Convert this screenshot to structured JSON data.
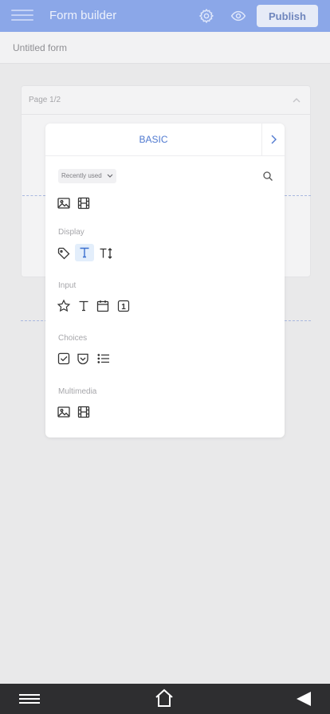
{
  "header": {
    "title": "Form builder",
    "publish_label": "Publish",
    "icons": [
      "menu-icon",
      "gear-icon",
      "eye-icon"
    ]
  },
  "form": {
    "name": "Untitled form"
  },
  "page": {
    "label": "Page 1/2"
  },
  "panel": {
    "tab_label": "BASIC",
    "filter_label": "Recently used",
    "sections": [
      {
        "label": "",
        "items": [
          "image",
          "video"
        ]
      },
      {
        "label": "Display",
        "items": [
          "tag",
          "text",
          "text-resize"
        ]
      },
      {
        "label": "Input",
        "items": [
          "star-rating",
          "text",
          "date",
          "number"
        ]
      },
      {
        "label": "Choices",
        "items": [
          "checkbox",
          "dropdown",
          "list"
        ]
      },
      {
        "label": "Multimedia",
        "items": [
          "image",
          "video"
        ]
      }
    ],
    "number_glyph": "1"
  },
  "colors": {
    "header_bg": "#8ba7e8",
    "accent": "#4f79d0",
    "navbar_bg": "#2e2e30"
  }
}
